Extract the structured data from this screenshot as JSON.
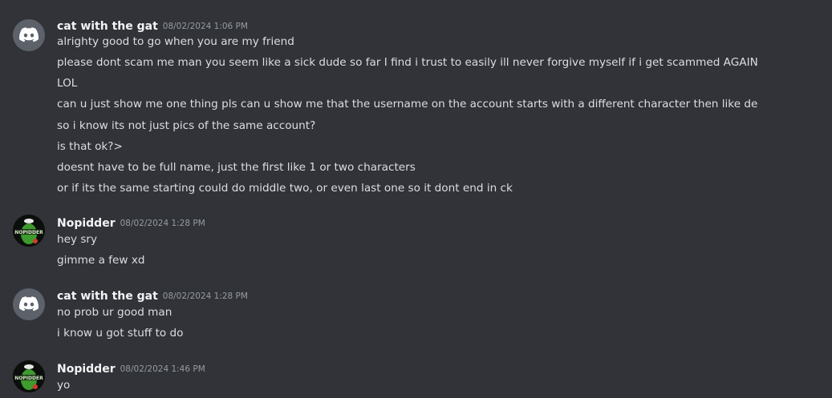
{
  "messages": [
    {
      "username": "cat with the gat",
      "timestamp": "08/02/2024 1:06 PM",
      "avatar_icon": "discord-logo-icon",
      "lines": [
        "alrighty good to go when you are my friend",
        "please dont scam me man you seem like a sick dude so far I find i trust to easily ill never forgive myself if i get scammed AGAIN",
        "LOL",
        "can u just show me one thing pls can u show me that the username on the account starts with a different character then like de",
        "so i know its not just pics of the same account?",
        "is that ok?>",
        "doesnt have to be full name, just the first like 1 or two characters",
        "or if its the same starting could do middle two, or even last one so it dont end in ck"
      ]
    },
    {
      "username": "Nopidder",
      "timestamp": "08/02/2024 1:28 PM",
      "avatar_icon": "nopidder-avatar-image",
      "lines": [
        "hey sry",
        "gimme a few xd"
      ]
    },
    {
      "username": "cat with the gat",
      "timestamp": "08/02/2024 1:28 PM",
      "avatar_icon": "discord-logo-icon",
      "lines": [
        "no prob ur good man",
        "i know u got stuff to do"
      ]
    },
    {
      "username": "Nopidder",
      "timestamp": "08/02/2024 1:46 PM",
      "avatar_icon": "nopidder-avatar-image",
      "lines": [
        "yo"
      ]
    }
  ],
  "colors": {
    "background": "#313338",
    "username": "#f2f3f5",
    "message_text": "#dbdee1",
    "timestamp": "#949ba4",
    "default_avatar": "#5d6169"
  }
}
